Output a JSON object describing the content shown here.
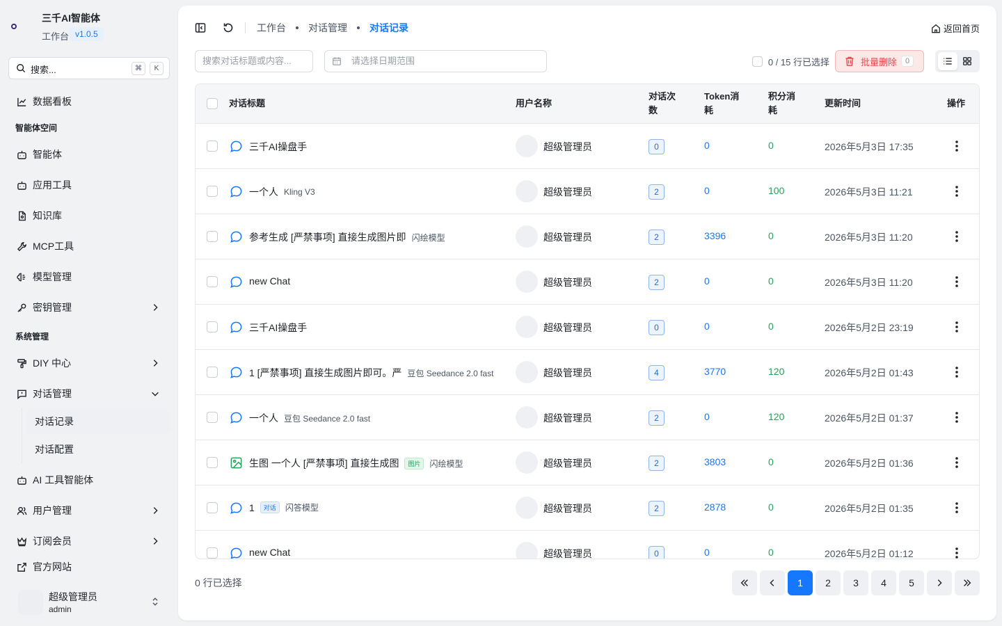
{
  "brand": {
    "title": "三千AI智能体",
    "subtitle": "工作台",
    "version": "v1.0.5"
  },
  "search": {
    "label": "搜索...",
    "kbd1": "⌘",
    "kbd2": "K"
  },
  "nav": {
    "dashboard": "数据看板",
    "group_agent": "智能体空间",
    "agents": "智能体",
    "app_tools": "应用工具",
    "knowledge": "知识库",
    "mcp_tools": "MCP工具",
    "models": "模型管理",
    "keys": "密钥管理",
    "group_system": "系统管理",
    "diy": "DIY 中心",
    "conversations": "对话管理",
    "conv_records": "对话记录",
    "conv_config": "对话配置",
    "ai_tools": "AI 工具智能体",
    "users": "用户管理",
    "subscriptions": "订阅会员",
    "website": "官方网站"
  },
  "user": {
    "name": "超级管理员",
    "account": "admin"
  },
  "breadcrumb": {
    "home": "工作台",
    "parent": "对话管理",
    "current": "对话记录"
  },
  "header": {
    "back_home": "返回首页"
  },
  "filters": {
    "search_placeholder": "搜索对话标题或内容...",
    "date_placeholder": "请选择日期范围",
    "selection": "0 / 15 行已选择",
    "bulk_delete": "批量删除",
    "bulk_count": "0"
  },
  "table": {
    "columns": {
      "title": "对话标题",
      "user": "用户名称",
      "count_1": "对话次",
      "count_2": "数",
      "token_1": "Token消",
      "token_2": "耗",
      "points_1": "积分消",
      "points_2": "耗",
      "updated": "更新时间",
      "actions": "操作"
    },
    "rows": [
      {
        "title": "三千AI操盘手",
        "tag": "",
        "pill": "",
        "icon": "chat-icon",
        "user": "超级管理员",
        "count": "0",
        "token": "0",
        "points": "0",
        "time": "2026年5月3日 17:35"
      },
      {
        "title": "一个人",
        "tag": "Kling V3",
        "pill": "",
        "icon": "chat-icon",
        "user": "超级管理员",
        "count": "2",
        "token": "0",
        "points": "100",
        "time": "2026年5月3日 11:21"
      },
      {
        "title": "参考生成 [严禁事项] 直接生成图片即",
        "tag": "闪绘模型",
        "pill": "",
        "icon": "chat-icon",
        "user": "超级管理员",
        "count": "2",
        "token": "3396",
        "points": "0",
        "time": "2026年5月3日 11:20"
      },
      {
        "title": "new Chat",
        "tag": "",
        "pill": "",
        "icon": "chat-icon",
        "user": "超级管理员",
        "count": "2",
        "token": "0",
        "points": "0",
        "time": "2026年5月3日 11:20"
      },
      {
        "title": "三千AI操盘手",
        "tag": "",
        "pill": "",
        "icon": "chat-icon",
        "user": "超级管理员",
        "count": "0",
        "token": "0",
        "points": "0",
        "time": "2026年5月2日 23:19"
      },
      {
        "title": "1 [严禁事项] 直接生成图片即可。严",
        "tag": "豆包 Seedance 2.0 fast",
        "pill": "",
        "icon": "chat-icon",
        "user": "超级管理员",
        "count": "4",
        "token": "3770",
        "points": "120",
        "time": "2026年5月2日 01:43"
      },
      {
        "title": "一个人",
        "tag": "豆包 Seedance 2.0 fast",
        "pill": "",
        "icon": "chat-icon",
        "user": "超级管理员",
        "count": "2",
        "token": "0",
        "points": "120",
        "time": "2026年5月2日 01:37"
      },
      {
        "title": "生图 一个人 [严禁事项] 直接生成图",
        "tag": "闪绘模型",
        "pill": "图片",
        "pill_color": "green",
        "icon": "image-icon",
        "user": "超级管理员",
        "count": "2",
        "token": "3803",
        "points": "0",
        "time": "2026年5月2日 01:36"
      },
      {
        "title": "1",
        "tag": "闪答模型",
        "pill": "对话",
        "pill_color": "blue",
        "icon": "chat-icon",
        "user": "超级管理员",
        "count": "2",
        "token": "2878",
        "points": "0",
        "time": "2026年5月2日 01:35"
      },
      {
        "title": "new Chat",
        "tag": "",
        "pill": "",
        "icon": "chat-icon",
        "user": "超级管理员",
        "count": "0",
        "token": "0",
        "points": "0",
        "time": "2026年5月2日 01:12"
      }
    ]
  },
  "footer": {
    "selected": "0 行已选择"
  },
  "pagination": {
    "pages": [
      "1",
      "2",
      "3",
      "4",
      "5"
    ],
    "current": "1"
  },
  "colors": {
    "accent": "#1677ff",
    "success": "#22a35a",
    "danger": "#e5484d"
  }
}
